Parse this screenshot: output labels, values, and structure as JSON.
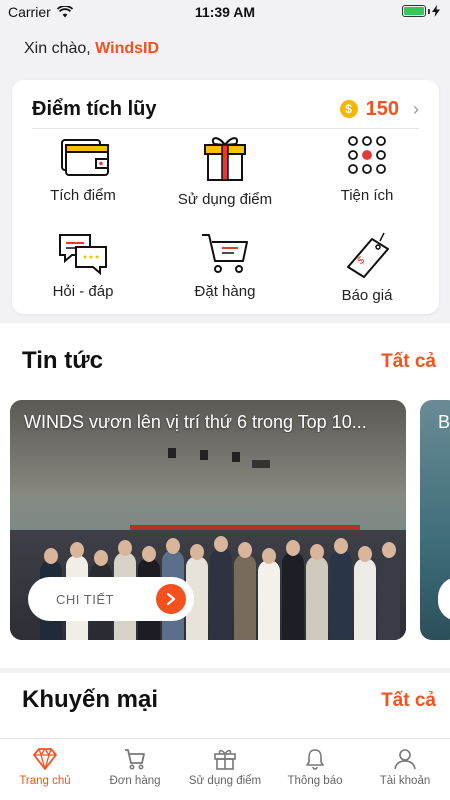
{
  "status_bar": {
    "carrier": "Carrier",
    "time": "11:39 AM"
  },
  "greeting": {
    "prefix": "Xin chào, ",
    "username": "WindsID"
  },
  "points_card": {
    "title": "Điểm tích lũy",
    "coin_icon": "coin-icon",
    "coin_symbol": "$",
    "points": "150",
    "items": [
      {
        "label": "Tích điểm",
        "icon": "wallet-icon"
      },
      {
        "label": "Sử dụng điểm",
        "icon": "gift-icon"
      },
      {
        "label": "Tiện ích",
        "icon": "apps-grid-icon"
      },
      {
        "label": "Hỏi - đáp",
        "icon": "chat-icon"
      },
      {
        "label": "Đặt hàng",
        "icon": "cart-icon"
      },
      {
        "label": "Báo giá",
        "icon": "price-tag-icon"
      }
    ]
  },
  "news": {
    "title": "Tin tức",
    "see_all": "Tất cả",
    "cards": [
      {
        "title": "WINDS vươn lên vị trí thứ 6 trong Top 10...",
        "button": "CHI TIẾT"
      },
      {
        "title": "B"
      }
    ]
  },
  "promotions": {
    "title": "Khuyến mại",
    "see_all": "Tất cả"
  },
  "tabbar": {
    "tabs": [
      {
        "label": "Trang chủ",
        "icon": "diamond-icon",
        "active": true
      },
      {
        "label": "Đơn hàng",
        "icon": "cart-icon"
      },
      {
        "label": "Sử dụng điểm",
        "icon": "gift-icon"
      },
      {
        "label": "Thông báo",
        "icon": "bell-icon"
      },
      {
        "label": "Tài khoản",
        "icon": "user-icon"
      }
    ]
  },
  "colors": {
    "accent": "#f4511e",
    "coin": "#f5b800",
    "battery": "#35c759"
  }
}
